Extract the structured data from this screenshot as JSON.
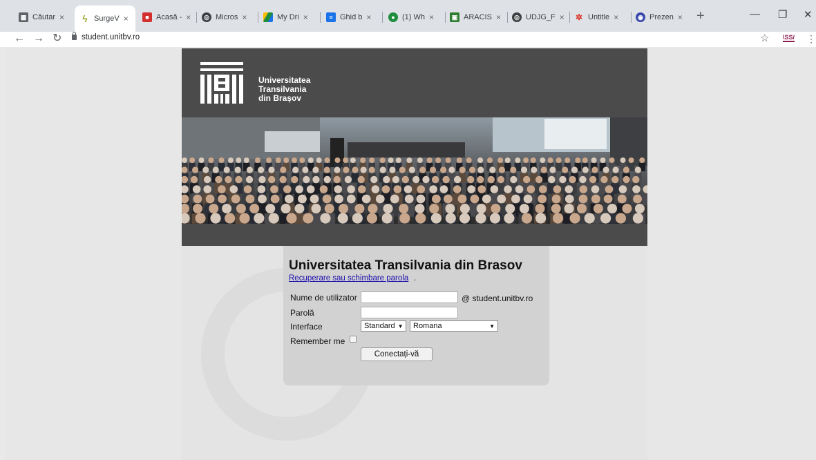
{
  "browser": {
    "tabs": [
      {
        "label": "Căutar",
        "icon": "calendar-icon",
        "color": "#5f6368"
      },
      {
        "label": "SurgeV",
        "icon": "bolt-icon",
        "color": "#9aa82a",
        "active": true
      },
      {
        "label": "Acasă -",
        "icon": "red-square-icon",
        "color": "#d32f2f"
      },
      {
        "label": "Micros",
        "icon": "globe-icon",
        "color": "#3c4043"
      },
      {
        "label": "My Dri",
        "icon": "drive-icon",
        "color": "#1e8e3e"
      },
      {
        "label": "Ghid b",
        "icon": "docs-icon",
        "color": "#1a73e8"
      },
      {
        "label": "(1) Wh",
        "icon": "green-circle-icon",
        "color": "#1e8e3e"
      },
      {
        "label": "ARACIS",
        "icon": "aracis-icon",
        "color": "#2e7d32"
      },
      {
        "label": "UDJG_F",
        "icon": "globe-icon",
        "color": "#3c4043"
      },
      {
        "label": "Untitle",
        "icon": "pinwheel-icon",
        "color": "#d93025"
      },
      {
        "label": "Prezen",
        "icon": "sites-icon",
        "color": "#3949ab"
      }
    ],
    "close_glyph": "×",
    "new_tab_glyph": "+",
    "url": "student.unitbv.ro",
    "extension_label": "\\SS/"
  },
  "header": {
    "logo_line1": "Universitatea",
    "logo_line2": "Transilvania",
    "logo_line3": "din Brașov"
  },
  "login": {
    "title": "Universitatea Transilvania din Brasov",
    "recover_link": "Recuperare sau schimbare parola",
    "recover_suffix": ".",
    "username_label": "Nume de utilizator",
    "username_value": "",
    "domain_suffix": "@ student.unitbv.ro",
    "password_label": "Parolă",
    "password_value": "",
    "interface_label": "Interface",
    "interface_style": "Standard",
    "interface_language": "Romana",
    "remember_label": "Remember me",
    "remember_checked": false,
    "submit_label": "Conectați-vă"
  },
  "colors": {
    "banner": "#4b4b4b",
    "card": "#d2d2d2",
    "link": "#1a0dab"
  }
}
